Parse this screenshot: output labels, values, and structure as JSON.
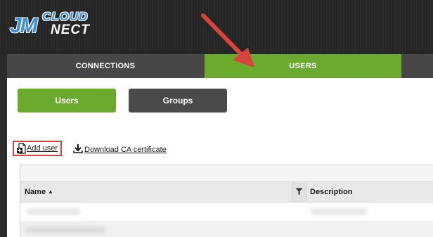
{
  "brand": {
    "logo_mark": "JM",
    "logo_top": "CLOUD",
    "logo_bottom": "NECT"
  },
  "tabs": [
    {
      "label": "CONNECTIONS",
      "active": false
    },
    {
      "label": "USERS",
      "active": true
    }
  ],
  "subnav": {
    "users_label": "Users",
    "groups_label": "Groups"
  },
  "actions": {
    "add_user_label": "Add user",
    "download_ca_label": "Download CA certificate"
  },
  "table": {
    "columns": [
      {
        "label": "Name",
        "sort": "▲"
      },
      {
        "label": "Description"
      }
    ]
  },
  "colors": {
    "accent_green": "#6aab2e",
    "dark_tab": "#474747",
    "annotation_red": "#d9433f"
  },
  "icons": {
    "filter": "funnel-icon",
    "add_user": "add-file-icon",
    "download": "download-icon"
  }
}
